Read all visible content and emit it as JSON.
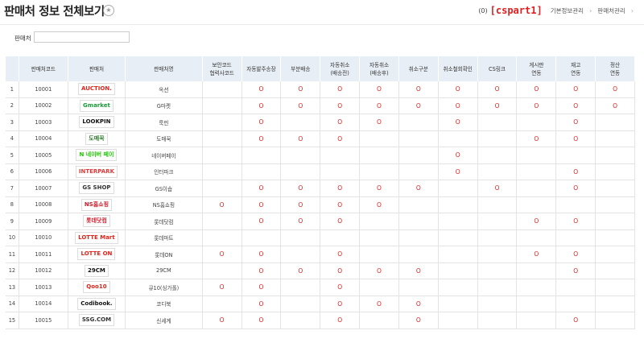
{
  "header": {
    "title": "판매처 정보 전체보기",
    "count": "(0)",
    "user": "[cspart1]",
    "breadcrumb": [
      "기본정보관리",
      "판매처관리"
    ]
  },
  "filter": {
    "label": "판매처",
    "value": ""
  },
  "columns": [
    "",
    "판매처코드",
    "판매처",
    "판매처명",
    "보안코드 협력사코드",
    "자동발주송장",
    "부분배송",
    "자동취소 (배송전)",
    "자동취소 (배송후)",
    "취소구분",
    "취소철회확인",
    "CS링크",
    "게시판 연동",
    "재고 연동",
    "정산 연동"
  ],
  "colors": {
    "accent": "#e02020",
    "header_bg": "#e8eef5"
  },
  "rows": [
    {
      "no": "1",
      "code": "10001",
      "logo": "AUCTION.",
      "logo_color": "#e0261c",
      "name": "옥션",
      "flags": [
        "",
        "O",
        "O",
        "O",
        "O",
        "O",
        "O",
        "O",
        "O",
        "O",
        "O"
      ]
    },
    {
      "no": "2",
      "code": "10002",
      "logo": "Gmarket",
      "logo_color": "#1a9b3a",
      "name": "G마켓",
      "flags": [
        "",
        "O",
        "O",
        "O",
        "O",
        "O",
        "O",
        "O",
        "O",
        "O",
        "O"
      ]
    },
    {
      "no": "3",
      "code": "10003",
      "logo": "LOOKPIN",
      "logo_color": "#111111",
      "name": "룩핀",
      "flags": [
        "",
        "O",
        "",
        "O",
        "O",
        "",
        "O",
        "",
        "",
        "O",
        ""
      ]
    },
    {
      "no": "4",
      "code": "10004",
      "logo": "도매꾹",
      "logo_color": "#2a7a2a",
      "name": "도매꾹",
      "flags": [
        "",
        "O",
        "O",
        "O",
        "",
        "",
        "",
        "",
        "O",
        "O",
        ""
      ]
    },
    {
      "no": "5",
      "code": "10005",
      "logo": "N 네이버 페이",
      "logo_color": "#1ec800",
      "name": "네이버페이",
      "flags": [
        "",
        "",
        "",
        "",
        "",
        "",
        "O",
        "",
        "",
        "",
        ""
      ]
    },
    {
      "no": "6",
      "code": "10006",
      "logo": "INTERPARK",
      "logo_color": "#e23a3a",
      "name": "인터파크",
      "flags": [
        "",
        "",
        "",
        "",
        "",
        "",
        "O",
        "",
        "",
        "O",
        ""
      ]
    },
    {
      "no": "7",
      "code": "10007",
      "logo": "GS SHOP",
      "logo_color": "#333333",
      "name": "GS이숍",
      "flags": [
        "",
        "O",
        "O",
        "O",
        "O",
        "O",
        "",
        "O",
        "",
        "O",
        ""
      ]
    },
    {
      "no": "8",
      "code": "10008",
      "logo": "NS홈쇼핑",
      "logo_color": "#d01c2c",
      "name": "NS홈쇼핑",
      "flags": [
        "O",
        "O",
        "O",
        "O",
        "O",
        "",
        "",
        "",
        "",
        "",
        ""
      ]
    },
    {
      "no": "9",
      "code": "10009",
      "logo": "롯데닷컴",
      "logo_color": "#d01c2c",
      "name": "롯데닷컴",
      "flags": [
        "",
        "O",
        "O",
        "O",
        "",
        "",
        "",
        "",
        "O",
        "O",
        ""
      ]
    },
    {
      "no": "10",
      "code": "10010",
      "logo": "LOTTE Mart",
      "logo_color": "#e0261c",
      "name": "롯데마트",
      "flags": [
        "",
        "",
        "",
        "",
        "",
        "",
        "",
        "",
        "",
        "",
        ""
      ]
    },
    {
      "no": "11",
      "code": "10011",
      "logo": "LOTTE ON",
      "logo_color": "#e0261c",
      "name": "롯데ON",
      "flags": [
        "O",
        "O",
        "",
        "O",
        "",
        "",
        "",
        "",
        "O",
        "O",
        ""
      ]
    },
    {
      "no": "12",
      "code": "10012",
      "logo": "29CM",
      "logo_color": "#111111",
      "name": "29CM",
      "flags": [
        "",
        "O",
        "O",
        "O",
        "O",
        "O",
        "",
        "",
        "",
        "O",
        ""
      ]
    },
    {
      "no": "13",
      "code": "10013",
      "logo": "Qoo10",
      "logo_color": "#e0261c",
      "name": "큐10(싱가폴)",
      "flags": [
        "O",
        "O",
        "",
        "O",
        "",
        "",
        "",
        "",
        "",
        "",
        ""
      ]
    },
    {
      "no": "14",
      "code": "10014",
      "logo": "Codibook.",
      "logo_color": "#111111",
      "name": "코디북",
      "flags": [
        "",
        "O",
        "",
        "O",
        "O",
        "O",
        "",
        "",
        "",
        "",
        ""
      ]
    },
    {
      "no": "15",
      "code": "10015",
      "logo": "SSG.COM",
      "logo_color": "#333333",
      "name": "신세계",
      "flags": [
        "O",
        "O",
        "",
        "O",
        "",
        "O",
        "",
        "",
        "",
        "O",
        ""
      ]
    }
  ]
}
